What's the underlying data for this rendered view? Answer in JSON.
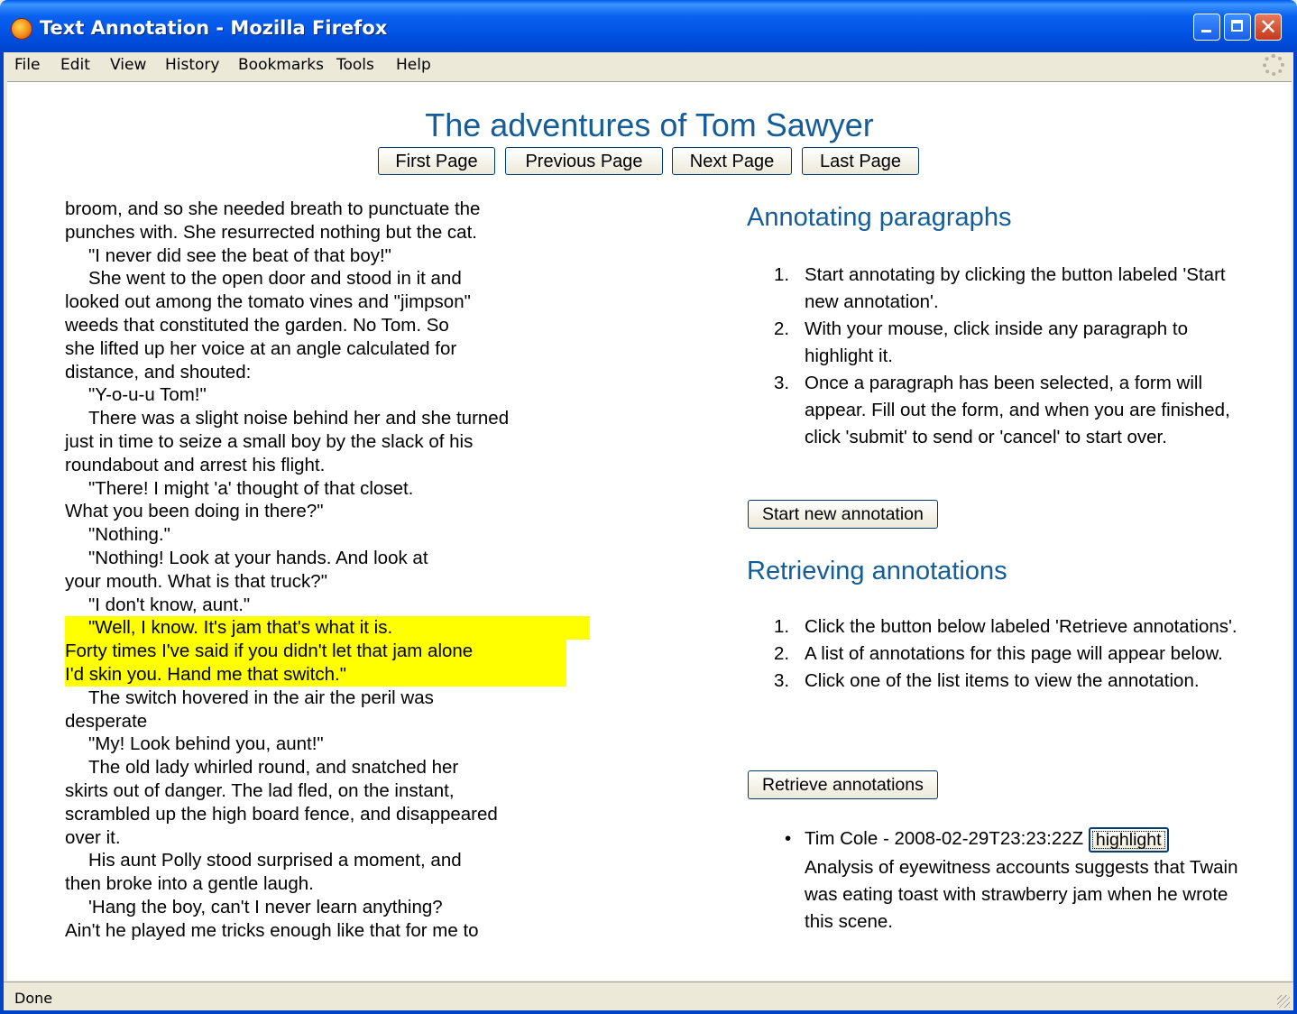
{
  "window": {
    "title": "Text Annotation - Mozilla Firefox",
    "close_glyph": "✕"
  },
  "menubar": {
    "items": [
      "File",
      "Edit",
      "View",
      "History",
      "Bookmarks",
      "Tools",
      "Help"
    ]
  },
  "page": {
    "title": "The adventures of Tom Sawyer",
    "nav": {
      "first": "First Page",
      "previous": "Previous Page",
      "next": "Next Page",
      "last": "Last Page"
    }
  },
  "book": {
    "lines": [
      {
        "text": "broom, and so she needed breath to punctuate the",
        "indent": false,
        "highlight": false
      },
      {
        "text": "punches with. She resurrected nothing but the cat.",
        "indent": false,
        "highlight": false
      },
      {
        "text": "\"I never did see the beat of that boy!\"",
        "indent": true,
        "highlight": false
      },
      {
        "text": "She went to the open door and stood in it and",
        "indent": true,
        "highlight": false
      },
      {
        "text": "looked out among the tomato vines and \"jimpson\"",
        "indent": false,
        "highlight": false
      },
      {
        "text": "weeds that constituted the garden. No Tom. So",
        "indent": false,
        "highlight": false
      },
      {
        "text": "she lifted up her voice at an angle calculated for",
        "indent": false,
        "highlight": false
      },
      {
        "text": "distance, and shouted:",
        "indent": false,
        "highlight": false
      },
      {
        "text": "\"Y-o-u-u Tom!\"",
        "indent": true,
        "highlight": false
      },
      {
        "text": "There was a slight noise behind her and she turned",
        "indent": true,
        "highlight": false
      },
      {
        "text": "just in time to seize a small boy by the slack of his",
        "indent": false,
        "highlight": false
      },
      {
        "text": "roundabout and arrest his flight.",
        "indent": false,
        "highlight": false
      },
      {
        "text": "\"There! I might 'a' thought of that closet.",
        "indent": true,
        "highlight": false
      },
      {
        "text": "What you been doing in there?\"",
        "indent": false,
        "highlight": false
      },
      {
        "text": "\"Nothing.\"",
        "indent": true,
        "highlight": false
      },
      {
        "text": "\"Nothing! Look at your hands. And look at",
        "indent": true,
        "highlight": false
      },
      {
        "text": "your mouth. What is that truck?\"",
        "indent": false,
        "highlight": false
      },
      {
        "text": "\"I don't know, aunt.\"",
        "indent": true,
        "highlight": false
      },
      {
        "text": "\"Well, I know. It's jam that's what it is.",
        "indent": true,
        "highlight": true
      },
      {
        "text": "Forty times I've said if you didn't let that jam alone",
        "indent": false,
        "highlight": true
      },
      {
        "text": "I'd skin you. Hand me that switch.\"",
        "indent": false,
        "highlight": true
      },
      {
        "text": "The switch hovered in the air the peril was",
        "indent": true,
        "highlight": false
      },
      {
        "text": "desperate",
        "indent": false,
        "highlight": false
      },
      {
        "text": "\"My! Look behind you, aunt!\"",
        "indent": true,
        "highlight": false
      },
      {
        "text": "The old lady whirled round, and snatched her",
        "indent": true,
        "highlight": false
      },
      {
        "text": "skirts out of danger. The lad fled, on the instant,",
        "indent": false,
        "highlight": false
      },
      {
        "text": "scrambled up the high board fence, and disappeared",
        "indent": false,
        "highlight": false
      },
      {
        "text": "over it.",
        "indent": false,
        "highlight": false
      },
      {
        "text": "His aunt Polly stood surprised a moment, and",
        "indent": true,
        "highlight": false
      },
      {
        "text": "then broke into a gentle laugh.",
        "indent": false,
        "highlight": false
      },
      {
        "text": "'Hang the boy, can't I never learn anything?",
        "indent": true,
        "highlight": false
      },
      {
        "text": "Ain't he played me tricks enough like that for me to",
        "indent": false,
        "highlight": false
      }
    ],
    "highlight_color": "#ffff00"
  },
  "annotating": {
    "heading": "Annotating paragraphs",
    "steps": [
      "Start annotating by clicking the button labeled 'Start new annotation'.",
      "With your mouse, click inside any paragraph to highlight it.",
      "Once a paragraph has been selected, a form will appear. Fill out the form, and when you are finished, click 'submit' to send or 'cancel' to start over."
    ],
    "button": "Start new annotation"
  },
  "retrieving": {
    "heading": "Retrieving annotations",
    "steps": [
      "Click the button below labeled 'Retrieve annotations'.",
      "A list of annotations for this page will appear below.",
      "Click one of the list items to view the annotation."
    ],
    "button": "Retrieve annotations"
  },
  "annotations": [
    {
      "header": "Tim Cole - 2008-02-29T23:23:22Z",
      "highlight_label": "highlight",
      "body": "Analysis of eyewitness accounts suggests that Twain was eating toast with strawberry jam when he wrote this scene."
    }
  ],
  "status": {
    "text": "Done"
  },
  "colors": {
    "heading": "#145d98",
    "titlebar": "#0050e0"
  }
}
